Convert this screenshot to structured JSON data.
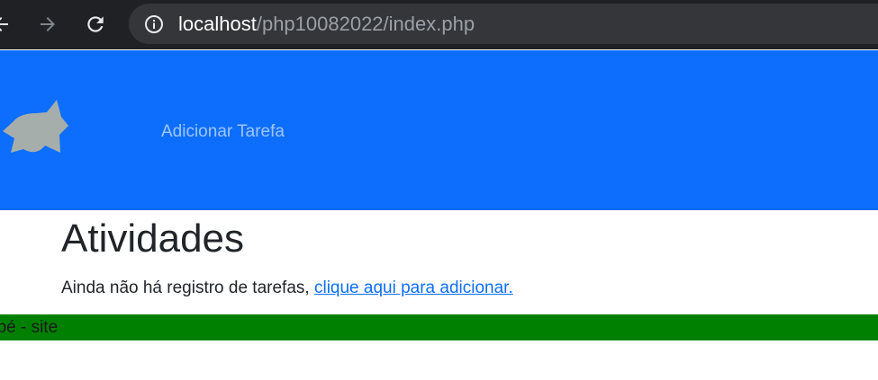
{
  "browser": {
    "back_icon": "arrow-left-icon",
    "forward_icon": "arrow-right-icon",
    "reload_icon": "reload-icon",
    "site_info_icon": "info-icon",
    "url_host": "localhost",
    "url_path": "/php10082022/index.php",
    "colors": {
      "toolbar": "#202124",
      "omnibox": "#35363a"
    }
  },
  "navbar": {
    "logo_icon": "star-blob-logo-icon",
    "link_label": "Adicionar Tarefa",
    "color": "#0d6efd"
  },
  "main": {
    "title": "Atividades",
    "empty_message": "Ainda não há registro de tarefas,",
    "add_link": "clique aqui para adicionar."
  },
  "footer": {
    "text": "apé - site",
    "color": "#008000"
  }
}
